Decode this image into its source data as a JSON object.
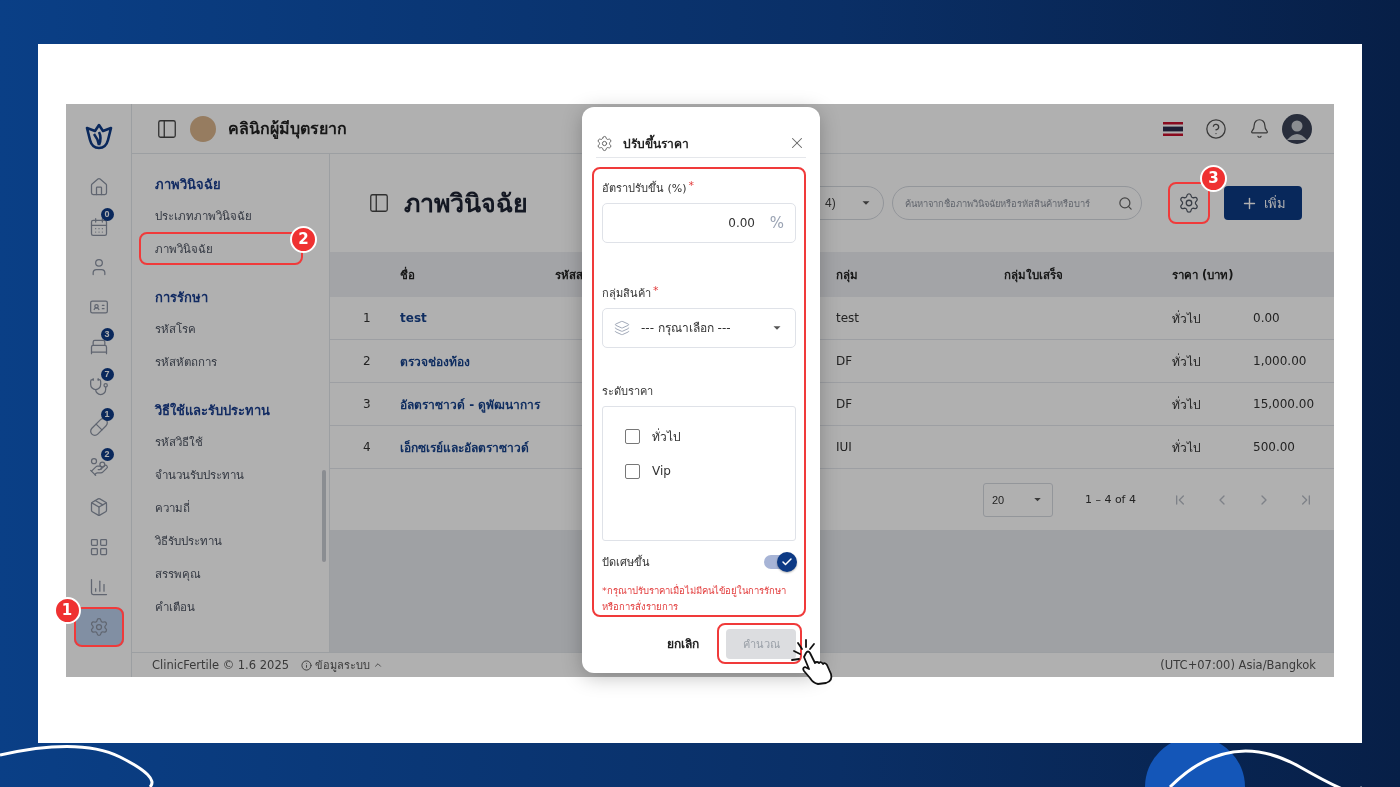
{
  "rail": {
    "items": [
      {
        "selected": false
      },
      {
        "selected": false,
        "badge": "0"
      },
      {
        "selected": false
      },
      {
        "selected": false
      },
      {
        "selected": false,
        "badge": "3"
      },
      {
        "selected": false,
        "badge": "7"
      },
      {
        "selected": false,
        "badge": "1"
      },
      {
        "selected": false,
        "badge": "2"
      },
      {
        "selected": false
      },
      {
        "selected": false
      },
      {
        "selected": false
      },
      {
        "selected": true,
        "callout": "1"
      }
    ]
  },
  "topbar": {
    "clinic_name": "คลินิกผู้มีบุตรยาก"
  },
  "submenu": {
    "sections": [
      {
        "heading": "ภาพวินิจฉัย",
        "items": [
          {
            "label": "ประเภทภาพวินิจฉัย"
          },
          {
            "label": "ภาพวินิจฉัย",
            "callout": "2"
          }
        ]
      },
      {
        "heading": "การรักษา",
        "items": [
          {
            "label": "รหัสโรค"
          },
          {
            "label": "รหัสหัตถการ"
          }
        ]
      },
      {
        "heading": "วิธีใช้และรับประทาน",
        "items": [
          {
            "label": "รหัสวิธีใช้"
          },
          {
            "label": "จำนวนรับประทาน"
          },
          {
            "label": "ความถี่"
          },
          {
            "label": "วิธีรับประทาน"
          },
          {
            "label": "สรรพคุณ"
          },
          {
            "label": "คำเตือน"
          }
        ]
      }
    ]
  },
  "page": {
    "title": "ภาพวินิจฉัย",
    "filter": {
      "value": "4)"
    },
    "search": {
      "placeholder": "ค้นหาจากชื่อภาพวินิจฉัยหรือรหัสสินค้าหรือบาร์"
    },
    "settings_button": {
      "callout": "3"
    },
    "add_button": "เพิ่ม"
  },
  "table": {
    "columns": [
      {
        "label": "ชื่อ"
      },
      {
        "label": "รหัสส"
      },
      {
        "label": "กลุ่ม"
      },
      {
        "label": "กลุ่มใบเสร็จ"
      },
      {
        "label": "ราคา (บาท)"
      }
    ],
    "rows": [
      {
        "number": "1",
        "name": "test",
        "group": "test",
        "price_level": "ทั่วไป",
        "price": "0.00"
      },
      {
        "number": "2",
        "name": "ตรวจช่องท้อง",
        "group": "DF",
        "price_level": "ทั่วไป",
        "price": "1,000.00"
      },
      {
        "number": "3",
        "name": "อัลตราซาวด์ - ดูพัฒนาการ",
        "group": "DF",
        "price_level": "ทั่วไป",
        "price": "15,000.00"
      },
      {
        "number": "4",
        "name": "เอ็กซเรย์และอัลตราซาวด์",
        "group": "IUI",
        "price_level": "ทั่วไป",
        "price": "500.00"
      }
    ]
  },
  "pagination": {
    "page_size": "20",
    "range": "1 – 4 of 4"
  },
  "footer": {
    "product": "ClinicFertile © 1.6 2025",
    "system_info": "ข้อมูลระบบ",
    "timezone": "(UTC+07:00) Asia/Bangkok"
  },
  "modal": {
    "title": "ปรับขึ้นราคา",
    "highlighted": true,
    "rate": {
      "label": "อัตราปรับขึ้น (%)",
      "required_mark": "*",
      "value": "0.00",
      "suffix": "%"
    },
    "product_group": {
      "label": "กลุ่มสินค้า",
      "required_mark": "*",
      "placeholder": "--- กรุณาเลือก ---"
    },
    "price_levels": {
      "label": "ระดับราคา",
      "options": [
        {
          "label": "ทั่วไป",
          "checked": false
        },
        {
          "label": "Vip",
          "checked": false
        }
      ]
    },
    "round_up": {
      "label": "ปัดเศษขึ้น",
      "on": true
    },
    "note": "*กรุณาปรับราคาเมื่อไม่มีคนไข้อยู่ในการรักษาหรือการสั่งรายการ",
    "cancel": "ยกเลิก",
    "calculate": {
      "label": "คำนวณ",
      "disabled": true,
      "highlighted": true
    }
  }
}
